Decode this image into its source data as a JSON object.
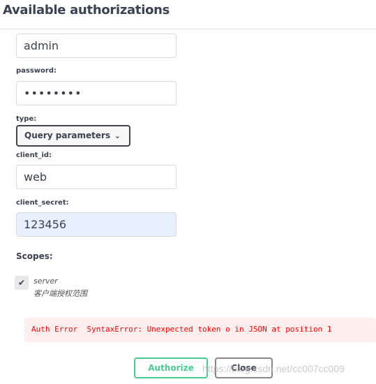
{
  "title": "Available authorizations",
  "fields": {
    "username_value": "admin",
    "password_label": "password:",
    "password_value": "••••••••",
    "type_label": "type:",
    "type_value": "Query parameters",
    "client_id_label": "client_id:",
    "client_id_value": "web",
    "client_secret_label": "client_secret:",
    "client_secret_value": "123456"
  },
  "scopes": {
    "label": "Scopes:",
    "items": [
      {
        "name": "server",
        "description": "客户端授权范围",
        "checked": true
      }
    ]
  },
  "error": "Auth Error  SyntaxError: Unexpected token o in JSON at position 1",
  "buttons": {
    "authorize": "Authorize",
    "close": "Close"
  },
  "watermark": "https://blog.csdn.net/cc007cc009",
  "colors": {
    "accent": "#49cc90",
    "error": "#ff0000",
    "error_bg": "#feeeee",
    "autofill_bg": "#e8f0fe"
  }
}
